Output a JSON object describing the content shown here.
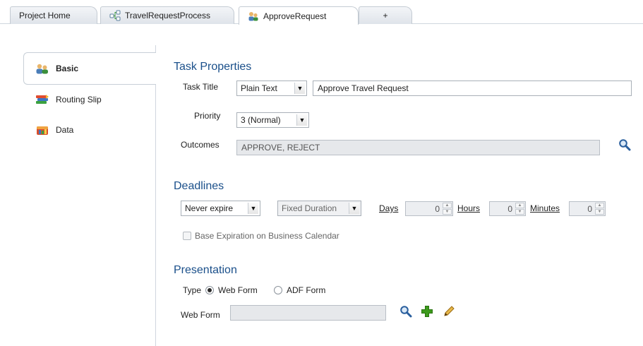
{
  "tabs": [
    {
      "label": "Project Home",
      "icon": "none"
    },
    {
      "label": "TravelRequestProcess",
      "icon": "process-icon"
    },
    {
      "label": "ApproveRequest",
      "icon": "human-task-icon"
    },
    {
      "label": "+",
      "icon": "none"
    }
  ],
  "nav": {
    "items": [
      {
        "label": "Basic",
        "icon": "basic-people-icon"
      },
      {
        "label": "Routing Slip",
        "icon": "routing-slip-icon"
      },
      {
        "label": "Data",
        "icon": "data-icon"
      }
    ]
  },
  "task_properties": {
    "title": "Task Properties",
    "task_title_label": "Task Title",
    "task_title_type": "Plain Text",
    "task_title_value": "Approve Travel Request",
    "priority_label": "Priority",
    "priority_value": "3 (Normal)",
    "outcomes_label": "Outcomes",
    "outcomes_value": "APPROVE, REJECT"
  },
  "deadlines": {
    "title": "Deadlines",
    "expire_value": "Never expire",
    "duration_value": "Fixed Duration",
    "days_label": "Days",
    "days_value": "0",
    "hours_label": "Hours",
    "hours_value": "0",
    "minutes_label": "Minutes",
    "minutes_value": "0",
    "business_calendar_label": "Base Expiration on Business Calendar"
  },
  "presentation": {
    "title": "Presentation",
    "type_label": "Type",
    "web_form_option": "Web Form",
    "adf_form_option": "ADF Form",
    "web_form_label": "Web Form",
    "web_form_value": ""
  },
  "colors": {
    "section_title": "#1a4f8a",
    "add_icon": "#3c9a1c",
    "search_icon": "#2a5f9e"
  }
}
